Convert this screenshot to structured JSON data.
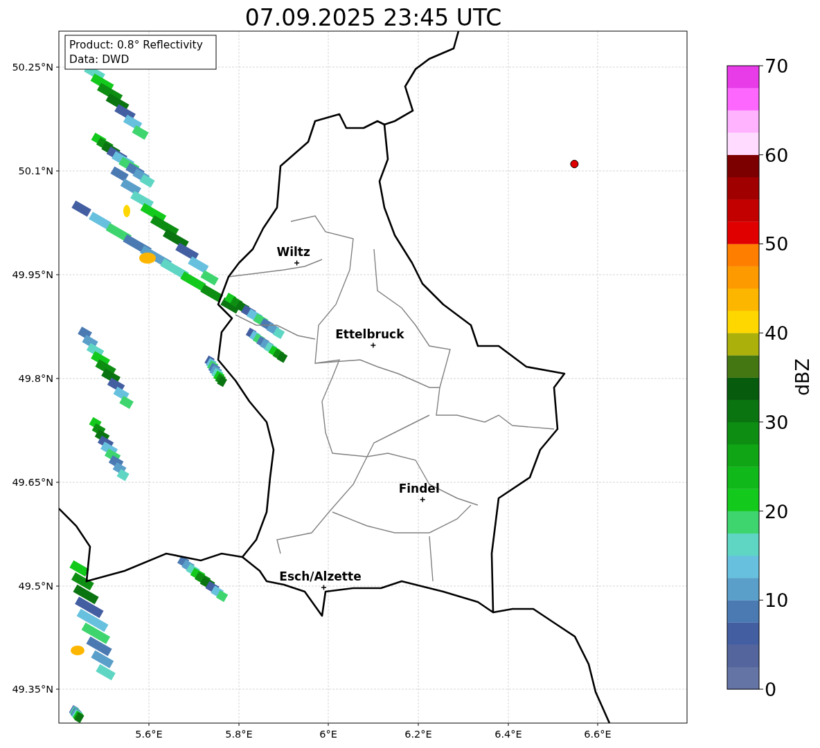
{
  "title": "07.09.2025 23:45 UTC",
  "info_box": [
    "Product: 0.8° Reflectivity",
    "Data: DWD"
  ],
  "y_ticks": [
    "50.25°N",
    "50.1°N",
    "49.95°N",
    "49.8°N",
    "49.65°N",
    "49.5°N",
    "49.35°N"
  ],
  "x_ticks": [
    "5.6°E",
    "5.8°E",
    "6°E",
    "6.2°E",
    "6.4°E",
    "6.6°E"
  ],
  "places": [
    {
      "name": "Wiltz"
    },
    {
      "name": "Ettelbruck"
    },
    {
      "name": "Findel"
    },
    {
      "name": "Esch/Alzette"
    }
  ],
  "colorbar": {
    "label": "dBZ",
    "ticks": [
      "70",
      "60",
      "50",
      "40",
      "30",
      "20",
      "10",
      "0"
    ],
    "bins": [
      {
        "color": "#6474a5"
      },
      {
        "color": "#53659c"
      },
      {
        "color": "#435ea1"
      },
      {
        "color": "#4b7ab3"
      },
      {
        "color": "#5a9fca"
      },
      {
        "color": "#67c1de"
      },
      {
        "color": "#5fd6c4"
      },
      {
        "color": "#3ed56f"
      },
      {
        "color": "#12c91c"
      },
      {
        "color": "#10b81a"
      },
      {
        "color": "#0fa514"
      },
      {
        "color": "#0d8e12"
      },
      {
        "color": "#0a7410"
      },
      {
        "color": "#065c0c"
      },
      {
        "color": "#447711"
      },
      {
        "color": "#acb00a"
      },
      {
        "color": "#fed700"
      },
      {
        "color": "#fdb600"
      },
      {
        "color": "#fd9a00"
      },
      {
        "color": "#fe7e00"
      },
      {
        "color": "#e10000"
      },
      {
        "color": "#c20000"
      },
      {
        "color": "#a10000"
      },
      {
        "color": "#7c0000"
      },
      {
        "color": "#ffdcff"
      },
      {
        "color": "#ffb3ff"
      },
      {
        "color": "#fe67fe"
      },
      {
        "color": "#e83ce8"
      }
    ]
  }
}
